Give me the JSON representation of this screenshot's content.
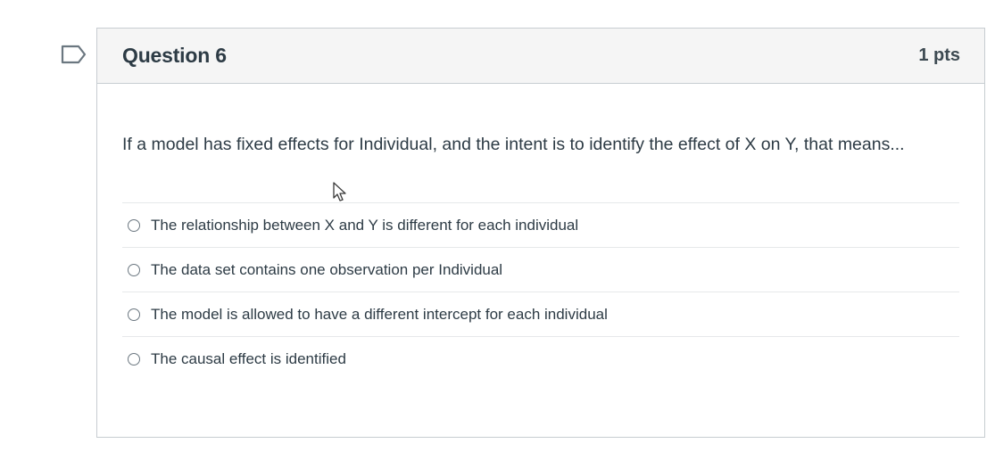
{
  "question": {
    "title": "Question 6",
    "points": "1 pts",
    "text": "If a model has fixed effects for Individual, and the intent is to identify the effect of X on Y, that means...",
    "answers": [
      {
        "label": "The relationship between X and Y is different for each individual"
      },
      {
        "label": "The data set contains one observation per Individual"
      },
      {
        "label": "The model is allowed to have a different intercept for each individual"
      },
      {
        "label": "The causal effect is identified"
      }
    ]
  },
  "icons": {
    "flag": "flag-outline-icon",
    "cursor": "mouse-pointer-icon"
  },
  "colors": {
    "header_bg": "#f5f5f5",
    "border": "#c7cdd1",
    "text": "#2d3b45"
  }
}
